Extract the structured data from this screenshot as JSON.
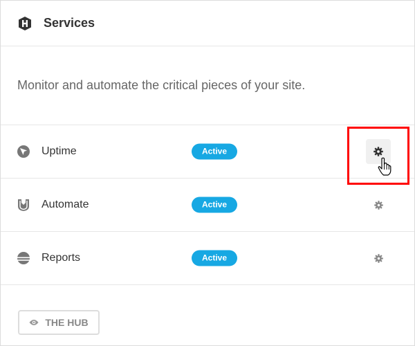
{
  "header": {
    "title": "Services",
    "logo_icon": "hub-logo-icon"
  },
  "description": "Monitor and automate the critical pieces of your site.",
  "services": [
    {
      "name": "Uptime",
      "status": "Active",
      "icon": "uptime-icon"
    },
    {
      "name": "Automate",
      "status": "Active",
      "icon": "automate-icon"
    },
    {
      "name": "Reports",
      "status": "Active",
      "icon": "reports-icon"
    }
  ],
  "hub_button": {
    "label": "THE HUB",
    "icon": "eye-icon"
  },
  "colors": {
    "badge": "#17a8e3",
    "highlight": "#ff0000",
    "icon": "#777777"
  }
}
